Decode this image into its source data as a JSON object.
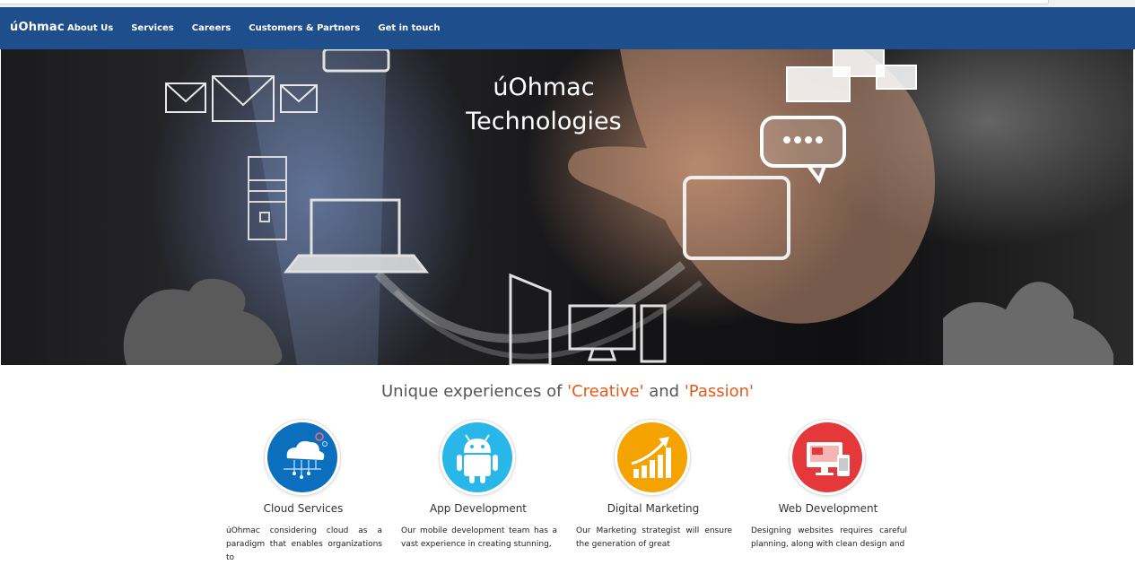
{
  "navbar": {
    "brand": "úOhmac",
    "links": [
      "About Us",
      "Services",
      "Careers",
      "Customers & Partners",
      "Get in touch"
    ]
  },
  "hero": {
    "title_line1": "úOhmac",
    "title_line2": "Technologies"
  },
  "tagline": {
    "prefix": "Unique experiences of ",
    "word1": "'Creative'",
    "middle": " and ",
    "word2": "'Passion'"
  },
  "services": [
    {
      "icon": "cloud-icon",
      "color": "#0b6fbe",
      "title": "Cloud Services",
      "desc": "úOhmac considering cloud as a paradigm that enables organizations to"
    },
    {
      "icon": "android-icon",
      "color": "#29b6e8",
      "title": "App Development",
      "desc": "Our mobile development team has a vast experience in creating stunning,"
    },
    {
      "icon": "growth-chart-icon",
      "color": "#f4a300",
      "title": "Digital Marketing",
      "desc": "Our Marketing strategist will ensure the generation of great"
    },
    {
      "icon": "devices-icon",
      "color": "#e5383b",
      "title": "Web Development",
      "desc": "Designing websites requires careful planning, along with clean design and"
    }
  ],
  "colors": {
    "navbar": "#1f4e8c",
    "accent": "#e45a1a"
  }
}
